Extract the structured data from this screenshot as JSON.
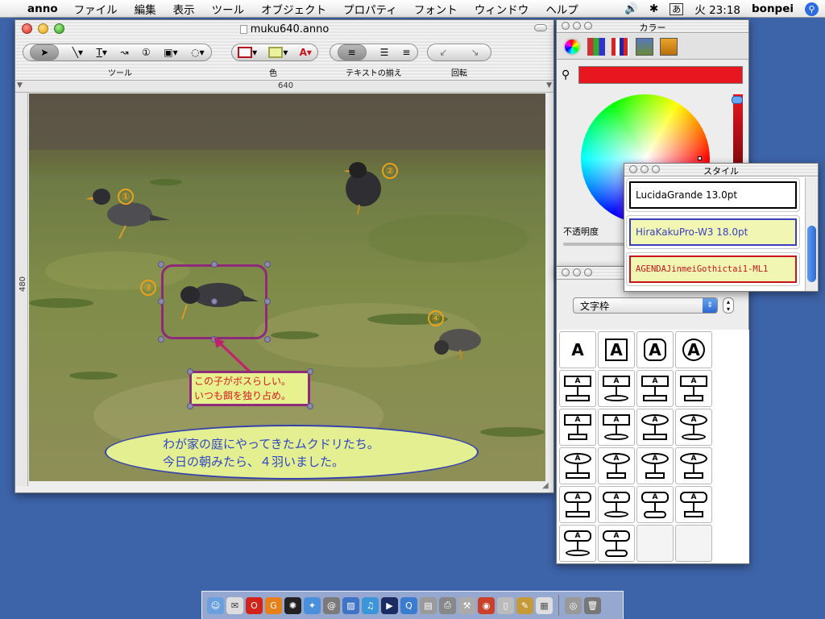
{
  "menubar": {
    "apple": "",
    "app": "anno",
    "items": [
      "ファイル",
      "編集",
      "表示",
      "ツール",
      "オブジェクト",
      "プロパティ",
      "フォント",
      "ウィンドウ",
      "ヘルプ"
    ],
    "ime": "あ",
    "clock": "火 23:18",
    "user": "bonpei"
  },
  "main_window": {
    "title": "muku640.anno",
    "groups": {
      "tools": "ツール",
      "color": "色",
      "align": "テキストの揃え",
      "rotate": "回転"
    },
    "ruler_top": "640",
    "ruler_left": "480"
  },
  "canvas": {
    "badges": [
      "①",
      "②",
      "③",
      "④"
    ],
    "callout_lines": [
      "この子がボスらしい。",
      "いつも餌を独り占め。"
    ],
    "ellipse_lines": [
      "わが家の庭にやってきたムクドリたち。",
      "今日の朝みたら、４羽いました。"
    ]
  },
  "colors": {
    "title": "カラー",
    "current_color": "#e8161f",
    "opacity_label": "不透明度"
  },
  "style_panel": {
    "title": "スタイル",
    "items": [
      {
        "label": "LucidaGrande 13.0pt"
      },
      {
        "label": "HiraKakuPro-W3 18.0pt"
      },
      {
        "label": "AGENDAJinmeiGothictai1-ML1"
      }
    ]
  },
  "frame_panel": {
    "select_value": "文字枠",
    "text_glyph": "A"
  }
}
